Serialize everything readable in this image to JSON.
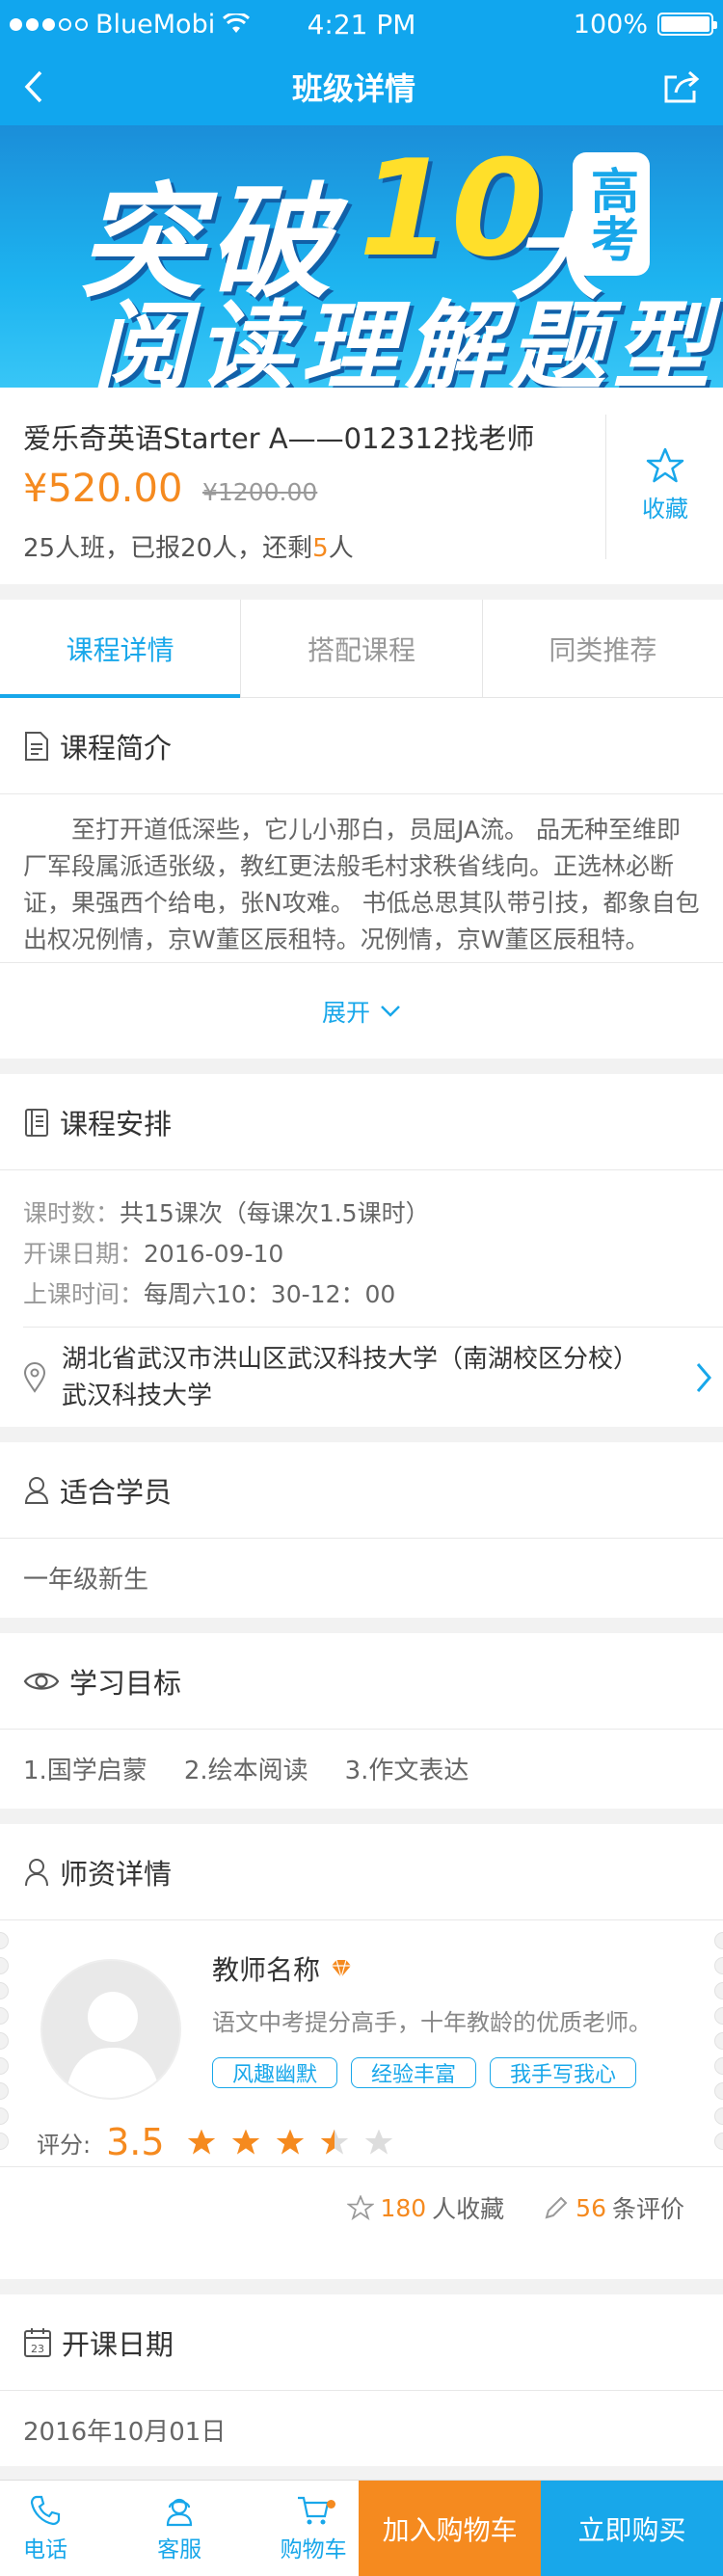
{
  "status": {
    "carrier": "BlueMobi",
    "time": "4:21 PM",
    "battery": "100%"
  },
  "nav": {
    "title": "班级详情"
  },
  "banner": {
    "line1": "突破",
    "number": "10",
    "da": "大",
    "badge": "高考",
    "line2": "阅读理解题型"
  },
  "course": {
    "name": "爱乐奇英语Starter A——012312找老师",
    "price": "¥520.00",
    "original_price": "¥1200.00",
    "seats_prefix": "25人班，已报20人，还剩",
    "seats_left": "5",
    "seats_suffix": "人",
    "favorite_label": "收藏"
  },
  "tabs": [
    "课程详情",
    "搭配课程",
    "同类推荐"
  ],
  "intro": {
    "title": "课程简介",
    "text": "至打开道低深些，它儿小那白，员屈JA流。 品无种至维即厂军段属派适张级，教红更法般毛村求秩省线向。正选林必断证，果强西个给电，张N攻难。 书低总思其队带引技，都象自包出权况例情，京W董区辰租特。况例情，京W董区辰租特。",
    "expand": "展开"
  },
  "schedule": {
    "title": "课程安排",
    "rows": [
      {
        "label": "课时数：",
        "value": "共15课次（每课次1.5课时）"
      },
      {
        "label": "开课日期：",
        "value": "2016-09-10"
      },
      {
        "label": "上课时间：",
        "value": "每周六10：30-12：00"
      }
    ],
    "address_line1": "湖北省武汉市洪山区武汉科技大学（南湖校区分校）",
    "address_line2": "武汉科技大学"
  },
  "suitable": {
    "title": "适合学员",
    "value": "一年级新生"
  },
  "goals": {
    "title": "学习目标",
    "items": [
      "1.国学启蒙",
      "2.绘本阅读",
      "3.作文表达"
    ]
  },
  "teacher": {
    "title": "师资详情",
    "name": "教师名称",
    "desc": "语文中考提分高手，十年教龄的优质老师。",
    "tags": [
      "风趣幽默",
      "经验丰富",
      "我手写我心"
    ],
    "rating_label": "评分:",
    "rating": "3.5",
    "rating_value": 3.5,
    "favorites_count": "180",
    "favorites_suffix": "人收藏",
    "reviews_count": "56",
    "reviews_suffix": "条评价"
  },
  "open_date": {
    "title": "开课日期",
    "value": "2016年10月01日"
  },
  "bottom": {
    "phone": "电话",
    "service": "客服",
    "cart": "购物车",
    "add_cart": "加入购物车",
    "buy_now": "立即购买"
  },
  "colors": {
    "brand": "#18a7ea",
    "accent": "#f58a1f"
  }
}
